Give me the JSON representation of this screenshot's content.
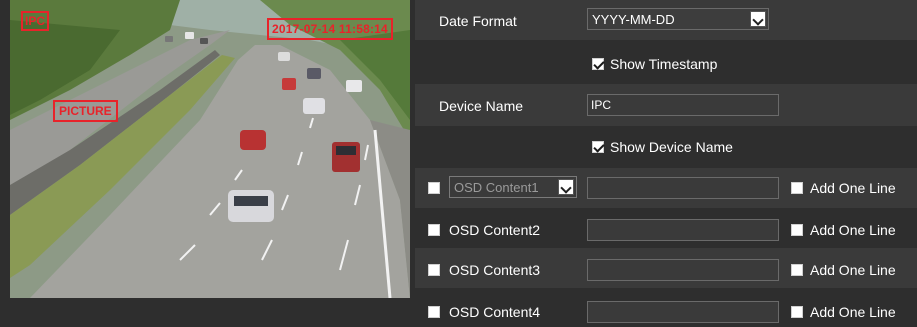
{
  "preview": {
    "osd_ipc": "IPC",
    "osd_timestamp": "2017-07-14 11:58:14",
    "osd_picture": "PICTURE"
  },
  "settings": {
    "date_format_label": "Date Format",
    "date_format_value": "YYYY-MM-DD",
    "show_timestamp_label": "Show Timestamp",
    "show_timestamp_checked": true,
    "device_name_label": "Device Name",
    "device_name_value": "IPC",
    "show_device_name_label": "Show Device Name",
    "show_device_name_checked": true,
    "osd_rows": [
      {
        "label": "OSD Content1",
        "value": "",
        "add_line_label": "Add One Line",
        "enabled": false,
        "add_line": false
      },
      {
        "label": "OSD Content2",
        "value": "",
        "add_line_label": "Add One Line",
        "enabled": false,
        "add_line": false
      },
      {
        "label": "OSD Content3",
        "value": "",
        "add_line_label": "Add One Line",
        "enabled": false,
        "add_line": false
      },
      {
        "label": "OSD Content4",
        "value": "",
        "add_line_label": "Add One Line",
        "enabled": false,
        "add_line": false
      }
    ]
  },
  "colors": {
    "osd_red": "#e8232a",
    "row_dark": "#3a3a3a",
    "row_light": "#2e2e2e"
  }
}
